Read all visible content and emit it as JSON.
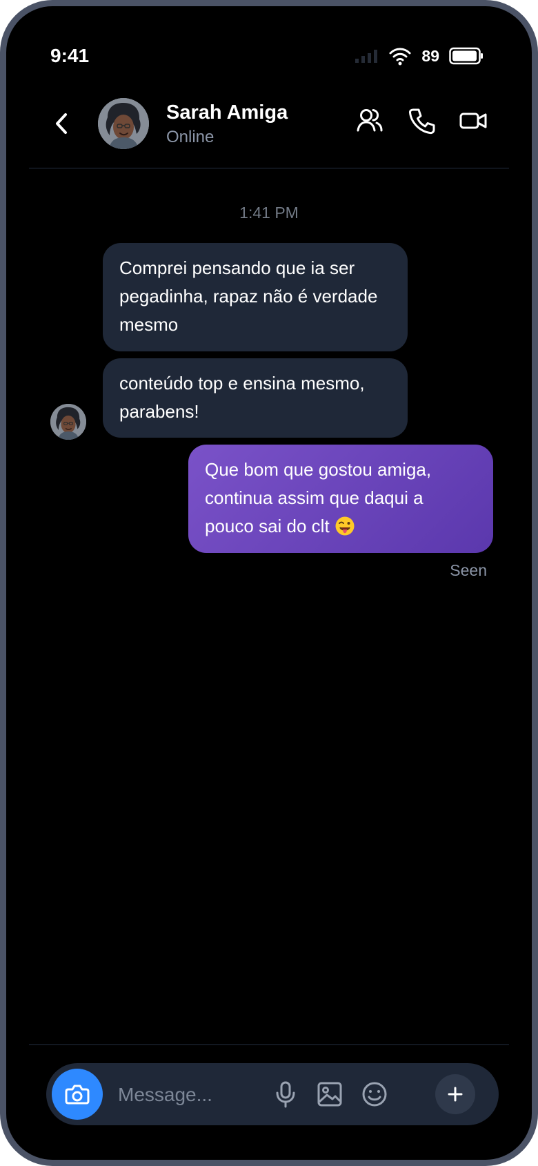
{
  "status_bar": {
    "time": "9:41",
    "battery": "89",
    "icons": [
      "signal-icon",
      "wifi-icon",
      "battery-icon"
    ]
  },
  "header": {
    "contact_name": "Sarah Amiga",
    "status": "Online",
    "actions": [
      "back-icon",
      "people-icon",
      "phone-icon",
      "video-icon"
    ]
  },
  "conversation": {
    "time_label": "1:41 PM",
    "messages": [
      {
        "direction": "incoming",
        "text": "Comprei pensando que ia ser pegadinha, rapaz não é verdade mesmo"
      },
      {
        "direction": "incoming",
        "text": "conteúdo top e ensina mesmo, parabens!"
      },
      {
        "direction": "outgoing",
        "text": "Que bom que gostou amiga, continua assim que daqui a pouco sai do clt",
        "emoji": "winking-face-with-tongue"
      }
    ],
    "seen_label": "Seen"
  },
  "composer": {
    "placeholder": "Message...",
    "actions": [
      "camera-icon",
      "microphone-icon",
      "image-icon",
      "emoji-icon",
      "plus-icon"
    ]
  },
  "colors": {
    "background": "#000000",
    "incoming_bubble": "#1f2838",
    "outgoing_bubble_start": "#7a52c8",
    "outgoing_bubble_end": "#5b38ad",
    "camera_button": "#2e89ff",
    "muted_text": "#8b95a7"
  }
}
